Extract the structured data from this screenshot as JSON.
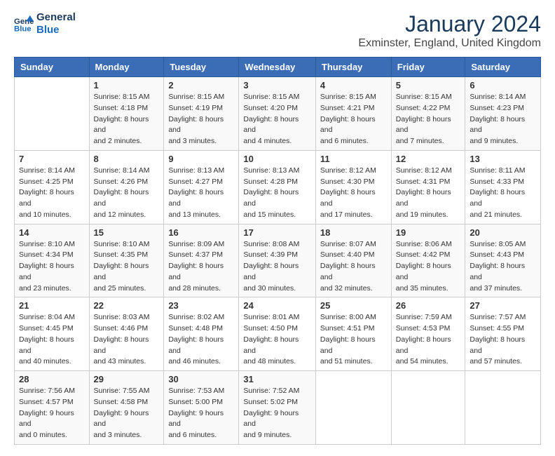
{
  "header": {
    "logo_line1": "General",
    "logo_line2": "Blue",
    "month_title": "January 2024",
    "location": "Exminster, England, United Kingdom"
  },
  "days_of_week": [
    "Sunday",
    "Monday",
    "Tuesday",
    "Wednesday",
    "Thursday",
    "Friday",
    "Saturday"
  ],
  "weeks": [
    [
      {
        "day": "",
        "sunrise": "",
        "sunset": "",
        "daylight": ""
      },
      {
        "day": "1",
        "sunrise": "Sunrise: 8:15 AM",
        "sunset": "Sunset: 4:18 PM",
        "daylight": "Daylight: 8 hours and 2 minutes."
      },
      {
        "day": "2",
        "sunrise": "Sunrise: 8:15 AM",
        "sunset": "Sunset: 4:19 PM",
        "daylight": "Daylight: 8 hours and 3 minutes."
      },
      {
        "day": "3",
        "sunrise": "Sunrise: 8:15 AM",
        "sunset": "Sunset: 4:20 PM",
        "daylight": "Daylight: 8 hours and 4 minutes."
      },
      {
        "day": "4",
        "sunrise": "Sunrise: 8:15 AM",
        "sunset": "Sunset: 4:21 PM",
        "daylight": "Daylight: 8 hours and 6 minutes."
      },
      {
        "day": "5",
        "sunrise": "Sunrise: 8:15 AM",
        "sunset": "Sunset: 4:22 PM",
        "daylight": "Daylight: 8 hours and 7 minutes."
      },
      {
        "day": "6",
        "sunrise": "Sunrise: 8:14 AM",
        "sunset": "Sunset: 4:23 PM",
        "daylight": "Daylight: 8 hours and 9 minutes."
      }
    ],
    [
      {
        "day": "7",
        "sunrise": "Sunrise: 8:14 AM",
        "sunset": "Sunset: 4:25 PM",
        "daylight": "Daylight: 8 hours and 10 minutes."
      },
      {
        "day": "8",
        "sunrise": "Sunrise: 8:14 AM",
        "sunset": "Sunset: 4:26 PM",
        "daylight": "Daylight: 8 hours and 12 minutes."
      },
      {
        "day": "9",
        "sunrise": "Sunrise: 8:13 AM",
        "sunset": "Sunset: 4:27 PM",
        "daylight": "Daylight: 8 hours and 13 minutes."
      },
      {
        "day": "10",
        "sunrise": "Sunrise: 8:13 AM",
        "sunset": "Sunset: 4:28 PM",
        "daylight": "Daylight: 8 hours and 15 minutes."
      },
      {
        "day": "11",
        "sunrise": "Sunrise: 8:12 AM",
        "sunset": "Sunset: 4:30 PM",
        "daylight": "Daylight: 8 hours and 17 minutes."
      },
      {
        "day": "12",
        "sunrise": "Sunrise: 8:12 AM",
        "sunset": "Sunset: 4:31 PM",
        "daylight": "Daylight: 8 hours and 19 minutes."
      },
      {
        "day": "13",
        "sunrise": "Sunrise: 8:11 AM",
        "sunset": "Sunset: 4:33 PM",
        "daylight": "Daylight: 8 hours and 21 minutes."
      }
    ],
    [
      {
        "day": "14",
        "sunrise": "Sunrise: 8:10 AM",
        "sunset": "Sunset: 4:34 PM",
        "daylight": "Daylight: 8 hours and 23 minutes."
      },
      {
        "day": "15",
        "sunrise": "Sunrise: 8:10 AM",
        "sunset": "Sunset: 4:35 PM",
        "daylight": "Daylight: 8 hours and 25 minutes."
      },
      {
        "day": "16",
        "sunrise": "Sunrise: 8:09 AM",
        "sunset": "Sunset: 4:37 PM",
        "daylight": "Daylight: 8 hours and 28 minutes."
      },
      {
        "day": "17",
        "sunrise": "Sunrise: 8:08 AM",
        "sunset": "Sunset: 4:39 PM",
        "daylight": "Daylight: 8 hours and 30 minutes."
      },
      {
        "day": "18",
        "sunrise": "Sunrise: 8:07 AM",
        "sunset": "Sunset: 4:40 PM",
        "daylight": "Daylight: 8 hours and 32 minutes."
      },
      {
        "day": "19",
        "sunrise": "Sunrise: 8:06 AM",
        "sunset": "Sunset: 4:42 PM",
        "daylight": "Daylight: 8 hours and 35 minutes."
      },
      {
        "day": "20",
        "sunrise": "Sunrise: 8:05 AM",
        "sunset": "Sunset: 4:43 PM",
        "daylight": "Daylight: 8 hours and 37 minutes."
      }
    ],
    [
      {
        "day": "21",
        "sunrise": "Sunrise: 8:04 AM",
        "sunset": "Sunset: 4:45 PM",
        "daylight": "Daylight: 8 hours and 40 minutes."
      },
      {
        "day": "22",
        "sunrise": "Sunrise: 8:03 AM",
        "sunset": "Sunset: 4:46 PM",
        "daylight": "Daylight: 8 hours and 43 minutes."
      },
      {
        "day": "23",
        "sunrise": "Sunrise: 8:02 AM",
        "sunset": "Sunset: 4:48 PM",
        "daylight": "Daylight: 8 hours and 46 minutes."
      },
      {
        "day": "24",
        "sunrise": "Sunrise: 8:01 AM",
        "sunset": "Sunset: 4:50 PM",
        "daylight": "Daylight: 8 hours and 48 minutes."
      },
      {
        "day": "25",
        "sunrise": "Sunrise: 8:00 AM",
        "sunset": "Sunset: 4:51 PM",
        "daylight": "Daylight: 8 hours and 51 minutes."
      },
      {
        "day": "26",
        "sunrise": "Sunrise: 7:59 AM",
        "sunset": "Sunset: 4:53 PM",
        "daylight": "Daylight: 8 hours and 54 minutes."
      },
      {
        "day": "27",
        "sunrise": "Sunrise: 7:57 AM",
        "sunset": "Sunset: 4:55 PM",
        "daylight": "Daylight: 8 hours and 57 minutes."
      }
    ],
    [
      {
        "day": "28",
        "sunrise": "Sunrise: 7:56 AM",
        "sunset": "Sunset: 4:57 PM",
        "daylight": "Daylight: 9 hours and 0 minutes."
      },
      {
        "day": "29",
        "sunrise": "Sunrise: 7:55 AM",
        "sunset": "Sunset: 4:58 PM",
        "daylight": "Daylight: 9 hours and 3 minutes."
      },
      {
        "day": "30",
        "sunrise": "Sunrise: 7:53 AM",
        "sunset": "Sunset: 5:00 PM",
        "daylight": "Daylight: 9 hours and 6 minutes."
      },
      {
        "day": "31",
        "sunrise": "Sunrise: 7:52 AM",
        "sunset": "Sunset: 5:02 PM",
        "daylight": "Daylight: 9 hours and 9 minutes."
      },
      {
        "day": "",
        "sunrise": "",
        "sunset": "",
        "daylight": ""
      },
      {
        "day": "",
        "sunrise": "",
        "sunset": "",
        "daylight": ""
      },
      {
        "day": "",
        "sunrise": "",
        "sunset": "",
        "daylight": ""
      }
    ]
  ]
}
